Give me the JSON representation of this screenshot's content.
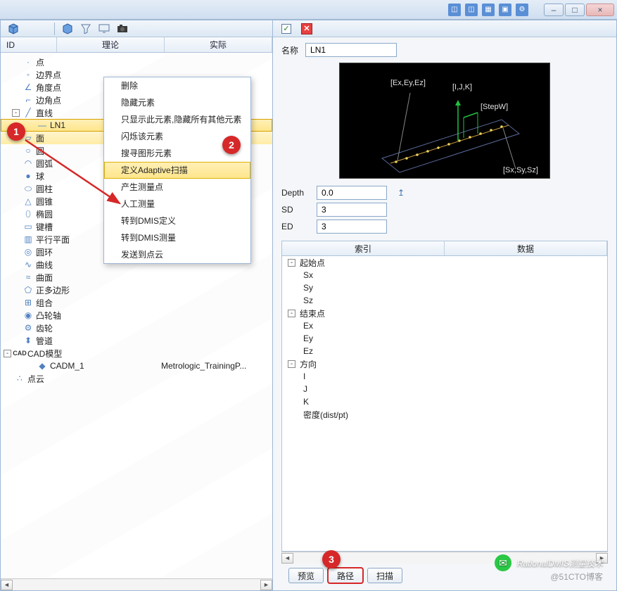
{
  "titlebar": {
    "min": "–",
    "max": "□",
    "close": "×"
  },
  "left": {
    "headers": {
      "id": "ID",
      "theory": "理论",
      "actual": "实际"
    },
    "tree": [
      {
        "icon": "point",
        "label": "点"
      },
      {
        "icon": "edge-point",
        "label": "边界点"
      },
      {
        "icon": "angle-point",
        "label": "角度点"
      },
      {
        "icon": "corner-point",
        "label": "边角点"
      },
      {
        "icon": "line",
        "label": "直线",
        "expander": "-"
      },
      {
        "icon": "line-item",
        "label": "LN1",
        "indent": 4,
        "selected": true
      },
      {
        "icon": "surface",
        "label": "面",
        "secondary": true
      },
      {
        "icon": "circle",
        "label": "圆"
      },
      {
        "icon": "arc",
        "label": "圆弧"
      },
      {
        "icon": "sphere",
        "label": "球"
      },
      {
        "icon": "cylinder",
        "label": "圆柱"
      },
      {
        "icon": "cone",
        "label": "圆锥"
      },
      {
        "icon": "ellipse",
        "label": "椭圆"
      },
      {
        "icon": "slot",
        "label": "键槽"
      },
      {
        "icon": "plane-parallel",
        "label": "平行平面"
      },
      {
        "icon": "torus",
        "label": "圆环"
      },
      {
        "icon": "curve",
        "label": "曲线"
      },
      {
        "icon": "surface-curve",
        "label": "曲面"
      },
      {
        "icon": "polygon",
        "label": "正多边形"
      },
      {
        "icon": "group",
        "label": "组合"
      },
      {
        "icon": "cam",
        "label": "凸轮轴"
      },
      {
        "icon": "gear",
        "label": "齿轮"
      },
      {
        "icon": "pipe",
        "label": "管道"
      },
      {
        "icon": "cad",
        "label": "CAD模型",
        "indent": 2,
        "expander": "-",
        "iconText": "CAD"
      },
      {
        "icon": "cad-item",
        "label": "CADM_1",
        "indent": 4,
        "actual": "Metrologic_TrainingP..."
      },
      {
        "icon": "pointcloud",
        "label": "点云",
        "indent": 2
      }
    ],
    "context_menu": [
      "删除",
      "隐藏元素",
      "只显示此元素,隐藏所有其他元素",
      "闪烁该元素",
      "搜寻图形元素",
      "定义Adaptive扫描",
      "产生测量点",
      "人工测量",
      "转到DMIS定义",
      "转到DMIS测量",
      "发送到点云"
    ],
    "context_hover_index": 5
  },
  "right": {
    "name": {
      "label": "名称",
      "value": "LN1"
    },
    "diagram": {
      "l1": "[Ex,Ey,Ez]",
      "l2": "[I,J,K]",
      "l3": "[StepW]",
      "l4": "[Sx,Sy,Sz]"
    },
    "params": {
      "depth": {
        "label": "Depth",
        "value": "0.0"
      },
      "sd": {
        "label": "SD",
        "value": "3"
      },
      "ed": {
        "label": "ED",
        "value": "3"
      }
    },
    "grid": {
      "headers": {
        "index": "索引",
        "data": "数据"
      },
      "rows": [
        {
          "exp": "-",
          "label": "起始点"
        },
        {
          "indent": true,
          "label": "Sx"
        },
        {
          "indent": true,
          "label": "Sy"
        },
        {
          "indent": true,
          "label": "Sz"
        },
        {
          "exp": "-",
          "label": "结束点"
        },
        {
          "indent": true,
          "label": "Ex"
        },
        {
          "indent": true,
          "label": "Ey"
        },
        {
          "indent": true,
          "label": "Ez"
        },
        {
          "exp": "-",
          "label": "方向"
        },
        {
          "indent": true,
          "label": "I"
        },
        {
          "indent": true,
          "label": "J"
        },
        {
          "indent": true,
          "label": "K"
        },
        {
          "indent": true,
          "label": "密度(dist/pt)"
        }
      ]
    },
    "buttons": {
      "preview": "预览",
      "path": "路径",
      "scan": "扫描"
    }
  },
  "annotations": {
    "a1": "1",
    "a2": "2",
    "a3": "3"
  },
  "watermark": {
    "brand": "RationalDMIS测量技术",
    "sub": "@51CTO博客"
  }
}
